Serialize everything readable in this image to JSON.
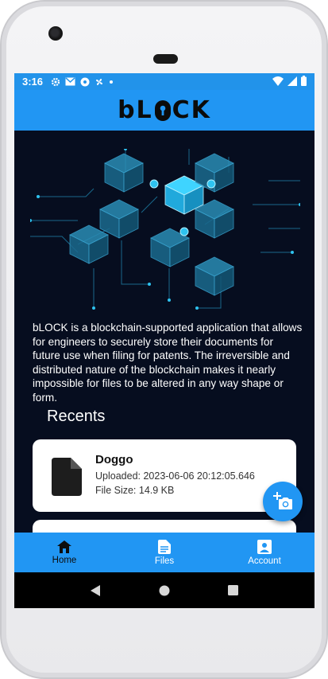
{
  "status_bar": {
    "time": "3:16",
    "left_icons": [
      "gear-icon",
      "gmail-icon",
      "chrome-icon",
      "fan-icon",
      "dot-icon"
    ],
    "right_icons": [
      "wifi-icon",
      "signal-icon",
      "battery-icon"
    ]
  },
  "app_bar": {
    "logo_text_left": "bL",
    "logo_text_right": "CK"
  },
  "intro": {
    "description": "bLOCK is a blockchain-supported application that allows for engineers to securely store their documents for future use when filing for patents. The irreversible and distributed nature of the blockchain makes it nearly impossible for files to be altered in any way shape or form."
  },
  "recents": {
    "title": "Recents",
    "items": [
      {
        "name": "Doggo",
        "uploaded": "Uploaded: 2023-06-06 20:12:05.646",
        "size": "File Size: 14.9 KB"
      }
    ]
  },
  "fab": {
    "icon": "add-photo-icon"
  },
  "bottom_nav": {
    "items": [
      {
        "label": "Home",
        "icon": "home-icon",
        "active": true
      },
      {
        "label": "Files",
        "icon": "file-icon",
        "active": false
      },
      {
        "label": "Account",
        "icon": "account-icon",
        "active": false
      }
    ]
  },
  "colors": {
    "primary": "#2196f3",
    "background": "#060d1f",
    "cube": "#1f7fa6",
    "cube_highlight": "#2ec3f0"
  }
}
